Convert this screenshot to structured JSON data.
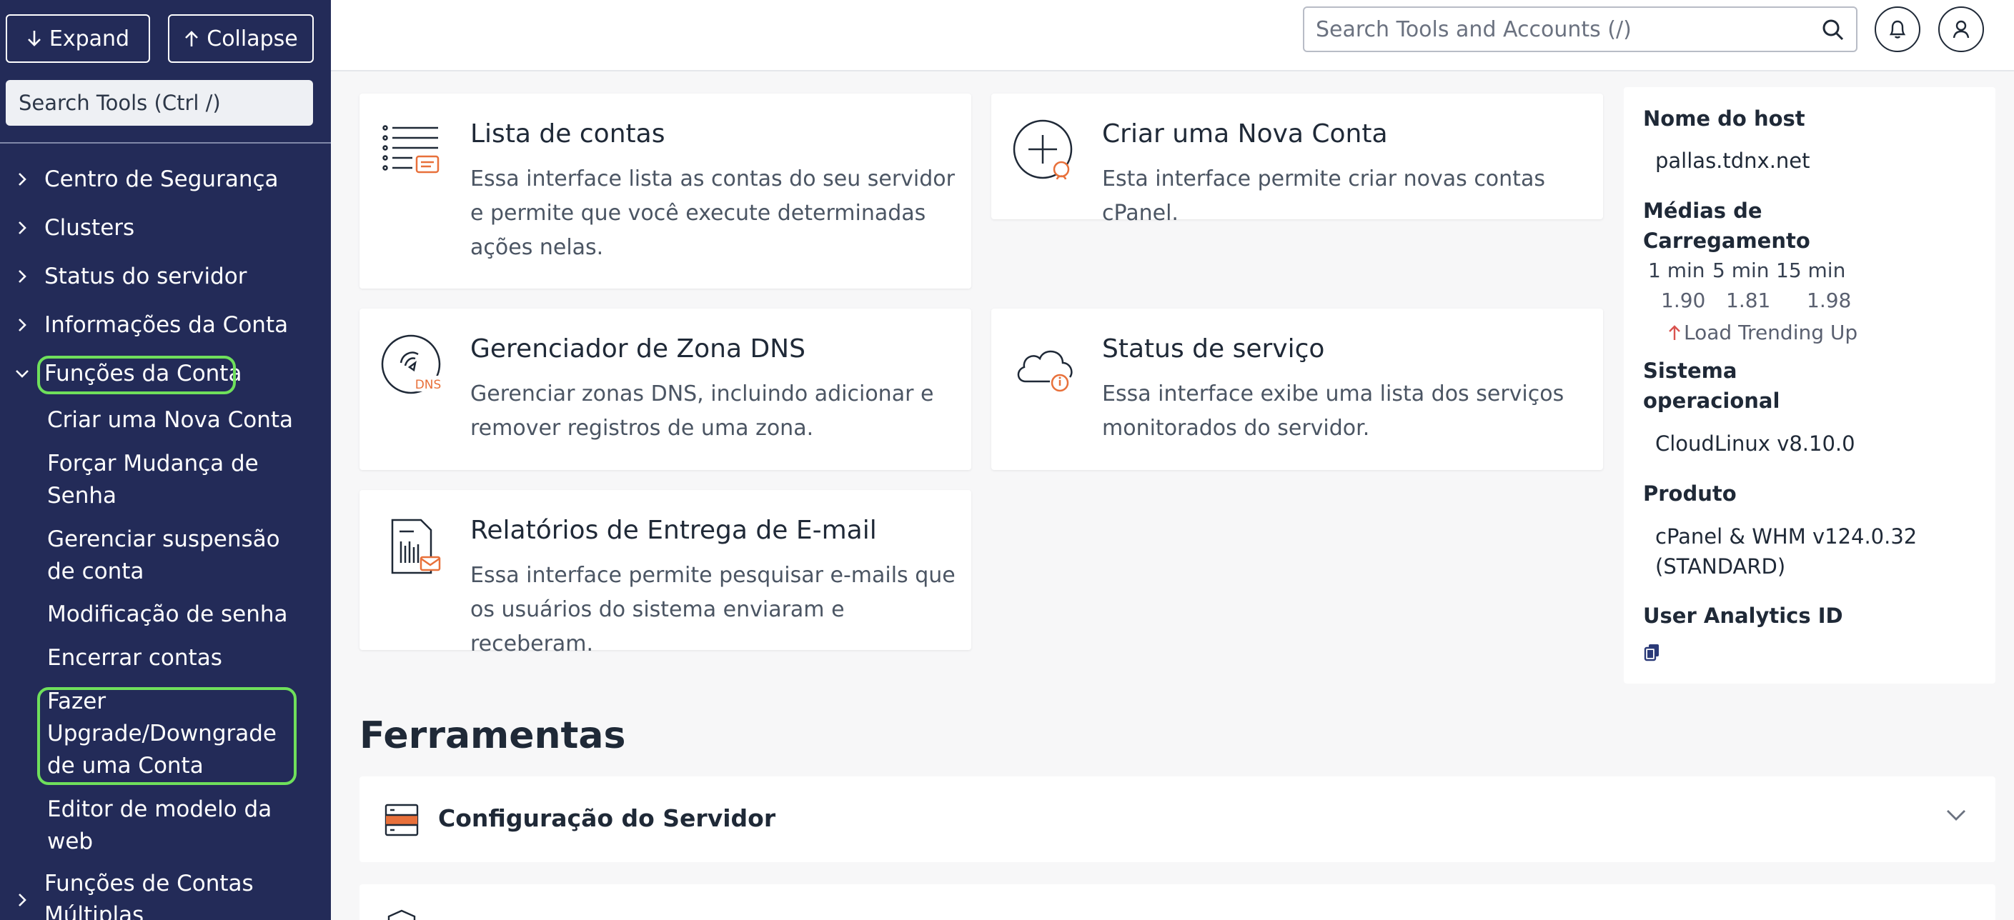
{
  "sidebar": {
    "expand_label": "Expand",
    "collapse_label": "Collapse",
    "search_placeholder": "Search Tools (Ctrl /)",
    "sections": [
      {
        "label": "Centro de Segurança"
      },
      {
        "label": "Clusters"
      },
      {
        "label": "Status do servidor"
      },
      {
        "label": "Informações da Conta"
      },
      {
        "label": "Funções da Conta"
      },
      {
        "label": "Funções de Contas Múltiplas"
      }
    ],
    "subitems": [
      {
        "label": "Criar uma Nova Conta"
      },
      {
        "label": "Forçar Mudança de Senha"
      },
      {
        "label": "Gerenciar suspensão de conta"
      },
      {
        "label": "Modificação de senha"
      },
      {
        "label": "Encerrar contas"
      },
      {
        "label": "Fazer Upgrade/Downgrade de uma Conta"
      },
      {
        "label": "Editor de modelo da web"
      }
    ]
  },
  "topbar": {
    "search_placeholder": "Search Tools and Accounts (/)"
  },
  "cards": [
    {
      "title": "Lista de contas",
      "desc": "Essa interface lista as contas do seu servidor e permite que você execute determinadas ações nelas.",
      "icon": "list-accounts-icon"
    },
    {
      "title": "Criar uma Nova Conta",
      "desc": "Esta interface permite criar novas contas cPanel.",
      "icon": "create-account-icon"
    },
    {
      "title": "Gerenciador de Zona DNS",
      "desc": "Gerenciar zonas DNS, incluindo adicionar e remover registros de uma zona.",
      "icon": "dns-icon",
      "icon_text": "DNS"
    },
    {
      "title": "Status de serviço",
      "desc": "Essa interface exibe uma lista dos serviços monitorados do servidor.",
      "icon": "cloud-status-icon"
    },
    {
      "title": "Relatórios de Entrega de E-mail",
      "desc": "Essa interface permite pesquisar e-mails que os usuários do sistema enviaram e receberam.",
      "icon": "email-report-icon"
    }
  ],
  "info": {
    "hostname_label": "Nome do host",
    "hostname": "pallas.tdnx.net",
    "load_label_1": "Médias de",
    "load_label_2": "Carregamento",
    "load_headers": [
      "1 min",
      "5 min",
      "15 min"
    ],
    "load_values": [
      "1.90",
      "1.81",
      "1.98"
    ],
    "load_trend": "Load Trending Up",
    "os_label_1": "Sistema",
    "os_label_2": "operacional",
    "os": "CloudLinux v8.10.0",
    "product_label": "Produto",
    "product_1": "cPanel & WHM v124.0.32",
    "product_2": "(STANDARD)",
    "analytics_label": "User Analytics ID"
  },
  "tools": {
    "title": "Ferramentas",
    "sections": [
      {
        "label": "Configuração do Servidor"
      }
    ]
  },
  "colors": {
    "sidebar_bg": "#232b58",
    "highlight": "#6fe05b",
    "accent_orange": "#e8703a",
    "trend_red": "#d9534f"
  }
}
